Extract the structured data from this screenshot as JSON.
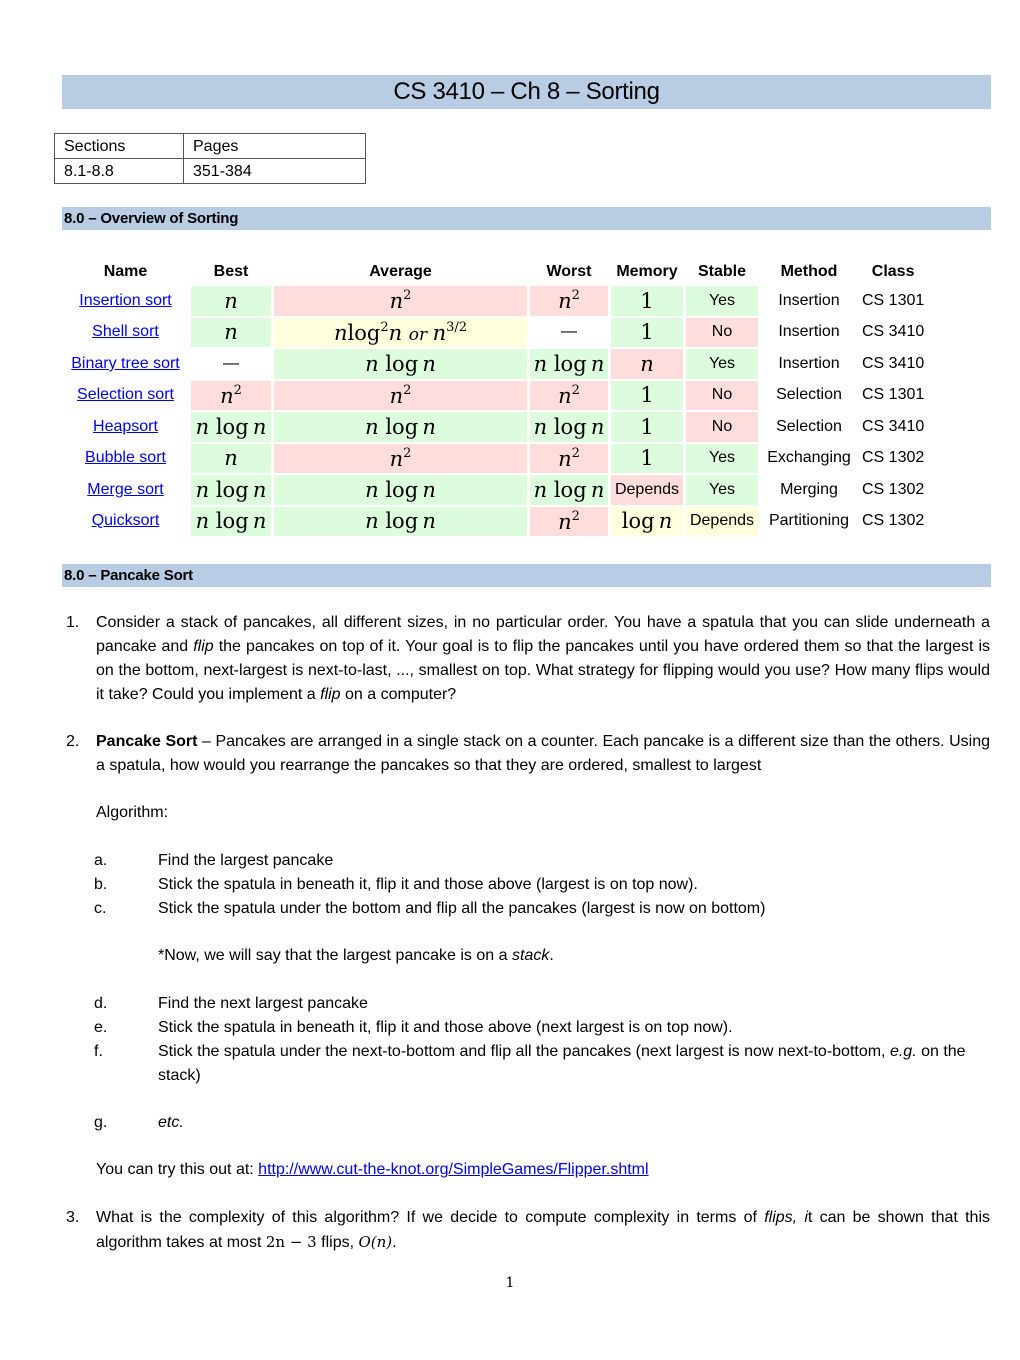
{
  "document": {
    "title": "CS 3410 – Ch 8 – Sorting",
    "page_number": "1"
  },
  "sections_table": {
    "headers": [
      "Sections",
      "Pages"
    ],
    "row": [
      "8.1-8.8",
      "351-384"
    ]
  },
  "overview": {
    "heading": "8.0 – Overview of Sorting",
    "columns": [
      "Name",
      "Best",
      "Average",
      "Worst",
      "Memory",
      "Stable",
      "Method",
      "Class"
    ],
    "cell_colors": {
      "good": "#ddfcdd",
      "bad": "#ffdddd",
      "medium": "#ffffdd",
      "none": "#ffffff"
    },
    "rows": [
      {
        "name": "Insertion sort",
        "best": "n",
        "average": "n²",
        "worst": "n²",
        "memory": "1",
        "stable": "Yes",
        "method": "Insertion",
        "class": "CS 1301"
      },
      {
        "name": "Shell sort",
        "best": "n",
        "average": "n log²n or n^3/2",
        "worst": "—",
        "memory": "1",
        "stable": "No",
        "method": "Insertion",
        "class": "CS 3410"
      },
      {
        "name": "Binary tree sort",
        "best": "—",
        "average": "n log n",
        "worst": "n log n",
        "memory": "n",
        "stable": "Yes",
        "method": "Insertion",
        "class": "CS 3410"
      },
      {
        "name": "Selection sort",
        "best": "n²",
        "average": "n²",
        "worst": "n²",
        "memory": "1",
        "stable": "No",
        "method": "Selection",
        "class": "CS 1301"
      },
      {
        "name": "Heapsort",
        "best": "n log n",
        "average": "n log n",
        "worst": "n log n",
        "memory": "1",
        "stable": "No",
        "method": "Selection",
        "class": "CS 3410"
      },
      {
        "name": "Bubble sort",
        "best": "n",
        "average": "n²",
        "worst": "n²",
        "memory": "1",
        "stable": "Yes",
        "method": "Exchanging",
        "class": "CS 1302"
      },
      {
        "name": "Merge sort",
        "best": "n log n",
        "average": "n log n",
        "worst": "n log n",
        "memory": "Depends",
        "stable": "Yes",
        "method": "Merging",
        "class": "CS 1302"
      },
      {
        "name": "Quicksort",
        "best": "n log n",
        "average": "n log n",
        "worst": "n²",
        "memory": "log n",
        "stable": "Depends",
        "method": "Partitioning",
        "class": "CS 1302"
      }
    ]
  },
  "pancake": {
    "heading": "8.0 – Pancake Sort",
    "item1": {
      "num": "1.",
      "t1": "Consider a stack of pancakes, all different sizes, in no particular order. You have a spatula that you can slide underneath a pancake and ",
      "flip": "flip",
      "t2": " the pancakes on top of it. Your goal is to flip the pancakes until you have ordered them so that the largest is on the bottom, next-largest is next-to-last, ..., smallest on top. What strategy for flipping would you use? How many flips would it take? Could you implement a ",
      "flip2": "flip",
      "t3": " on a computer?"
    },
    "item2": {
      "num": "2.",
      "bold": "Pancake Sort",
      "text": " – Pancakes are arranged in a single stack on a counter. Each pancake is a different size than the others. Using a spatula, how would you rearrange the pancakes so that they are ordered, smallest to largest",
      "algorithm_label": "Algorithm:"
    },
    "steps": [
      {
        "label": "a.",
        "text": "Find the largest pancake"
      },
      {
        "label": "b.",
        "text": "Stick the spatula in beneath it, flip it and those above (largest is on top now)."
      },
      {
        "label": "c.",
        "text": "Stick the spatula under the bottom and flip all the pancakes (largest is now on bottom)"
      },
      {
        "label": "d.",
        "text": "Find the next largest pancake"
      },
      {
        "label": "e.",
        "text": "Stick the spatula in beneath it, flip it and those above (next largest is on top now)."
      },
      {
        "label": "f.",
        "text": "Stick the spatula under the next-to-bottom and flip all the pancakes (next largest is now next-to-bottom, ",
        "eg": "e.g.",
        "text2": " on the stack)"
      },
      {
        "label": "g.",
        "text": "etc."
      }
    ],
    "note": {
      "prefix": "*Now, we will say that the largest pancake is on a ",
      "italic": "stack",
      "suffix": "."
    },
    "try_it": {
      "prefix": "You can try this out at:  ",
      "link": "http://www.cut-the-knot.org/SimpleGames/Flipper.shtml"
    },
    "item3": {
      "num": "3.",
      "t1": "What is the complexity of this algorithm? If we decide to compute complexity in terms of ",
      "flips": "flips, i",
      "t2": "t can be shown that this algorithm takes at most ",
      "formula": "2n − 3",
      "t3": " flips, ",
      "bigo": "O(n)",
      "t4": "."
    }
  }
}
